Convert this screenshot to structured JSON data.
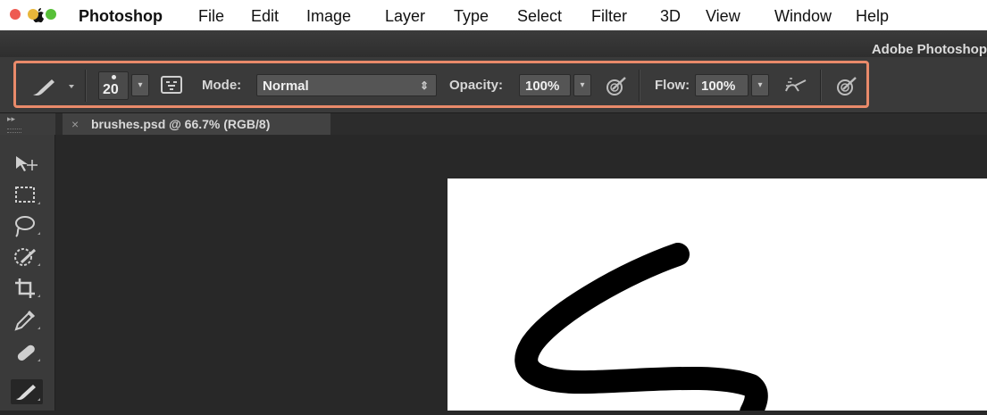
{
  "menubar": {
    "app_name": "Photoshop",
    "items": [
      "File",
      "Edit",
      "Image",
      "Layer",
      "Type",
      "Select",
      "Filter",
      "3D",
      "View",
      "Window",
      "Help"
    ]
  },
  "window": {
    "title": "Adobe Photoshop"
  },
  "options_bar": {
    "brush_size": "20",
    "mode_label": "Mode:",
    "mode_value": "Normal",
    "opacity_label": "Opacity:",
    "opacity_value": "100%",
    "flow_label": "Flow:",
    "flow_value": "100%",
    "highlight_color": "#e98a6a"
  },
  "document_tab": {
    "close_glyph": "×",
    "title": "brushes.psd @ 66.7% (RGB/8)"
  },
  "tools": [
    "move-tool",
    "marquee-tool",
    "lasso-tool",
    "quick-selection-tool",
    "crop-tool",
    "eyedropper-tool",
    "healing-brush-tool",
    "brush-tool"
  ],
  "active_tool": "brush-tool"
}
